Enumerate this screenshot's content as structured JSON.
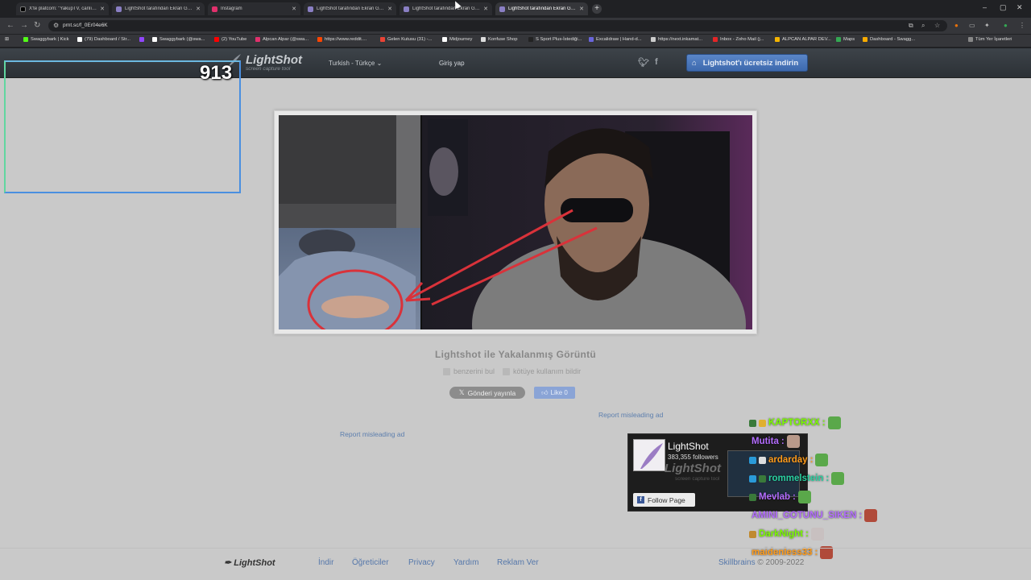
{
  "browser": {
    "tabs": [
      {
        "title": "X'te platcom: \"YakupTV, canlı y...",
        "favicon_color": "#ffffff",
        "active": false
      },
      {
        "title": "LightShot tarafından Ekran Görü...",
        "favicon_color": "#8a7fc4",
        "active": false
      },
      {
        "title": "Instagram",
        "favicon_color": "#e1306c",
        "active": false
      },
      {
        "title": "LightShot tarafından Ekran Görü...",
        "favicon_color": "#8a7fc4",
        "active": false
      },
      {
        "title": "LightShot tarafından Ekran Görü...",
        "favicon_color": "#8a7fc4",
        "active": false
      },
      {
        "title": "LightShot tarafından Ekran Görü...",
        "favicon_color": "#8a7fc4",
        "active": true
      }
    ],
    "new_tab": "+",
    "url": "prnt.sc/f_0Er04e6K",
    "window_controls": [
      "–",
      "▢",
      "✕"
    ],
    "bookmarks": [
      {
        "label": "Swaggybark | Kick",
        "color": "#53fc18"
      },
      {
        "label": "(79) Dashboard / Str...",
        "color": "#ffffff"
      },
      {
        "label": "",
        "color": "#9146ff"
      },
      {
        "label": "Swaggybark (@swa...",
        "color": "#ffffff"
      },
      {
        "label": "(2) YouTube",
        "color": "#ff0000"
      },
      {
        "label": "Alpcan Alpar (@swa...",
        "color": "#e1306c"
      },
      {
        "label": "https://www.reddit....",
        "color": "#ff4500"
      },
      {
        "label": "Gelen Kutusu (31) -...",
        "color": "#ea4335"
      },
      {
        "label": "Midjourney",
        "color": "#ffffff"
      },
      {
        "label": "Konfuse Shop",
        "color": "#dddddd"
      },
      {
        "label": "S Sport Plus-İstediği...",
        "color": "#222222"
      },
      {
        "label": "Excalidraw | Hand-d...",
        "color": "#6965db"
      },
      {
        "label": "https://next.inkamat...",
        "color": "#cccccc"
      },
      {
        "label": "Inbox - Zoho Mail (j...",
        "color": "#e42527"
      },
      {
        "label": "ALPCAN ALPAR DEV...",
        "color": "#f4b400"
      },
      {
        "label": "Maps",
        "color": "#34a853"
      },
      {
        "label": "Dashboard - Swagg...",
        "color": "#f9ab00"
      }
    ],
    "all_bookmarks": "Tüm Yer İşaretleri"
  },
  "header": {
    "logo": "LightShot",
    "tagline": "screen capture tool",
    "language": "Turkish - Türkçe",
    "login": "Giriş yap",
    "download_button": "Lightshot'ı ücretsiz indirin"
  },
  "overlay": {
    "selection_number": "913"
  },
  "main": {
    "caption": "Lightshot ile Yakalanmış Görüntü",
    "find_similar": "benzerini bul",
    "report_abuse": "kötüye kullanım bildir",
    "tweet_button": "Gönderi yayınla",
    "like_button": "Like 0",
    "report_ad_1": "Report misleading ad",
    "report_ad_2": "Report misleading ad"
  },
  "fb_widget": {
    "page_name": "LightShot",
    "followers": "383,355 followers",
    "logo_text": "LightShot",
    "logo_sub": "screen capture tool",
    "follow_button": "Follow Page"
  },
  "chat": [
    {
      "user": "KAPTORXX",
      "color": "#7cfc00"
    },
    {
      "user": "Mutita",
      "color": "#b36cff"
    },
    {
      "user": "ardarday",
      "color": "#ff9b1a"
    },
    {
      "user": "rommelstein",
      "color": "#2ad0a0"
    },
    {
      "user": "Mevlab",
      "color": "#b36cff"
    },
    {
      "user": "AMINI_GOTUNU_SIKEN",
      "color": "#b36cff"
    },
    {
      "user": "DarkNight",
      "color": "#7cfc00"
    },
    {
      "user": "maidenless33",
      "color": "#ff9b1a"
    }
  ],
  "footer": {
    "logo": "LightShot",
    "links": [
      "İndir",
      "Öğreticiler",
      "Privacy",
      "Yardım",
      "Reklam Ver"
    ],
    "brand": "Skillbrains",
    "copyright": "© 2009-2022"
  }
}
